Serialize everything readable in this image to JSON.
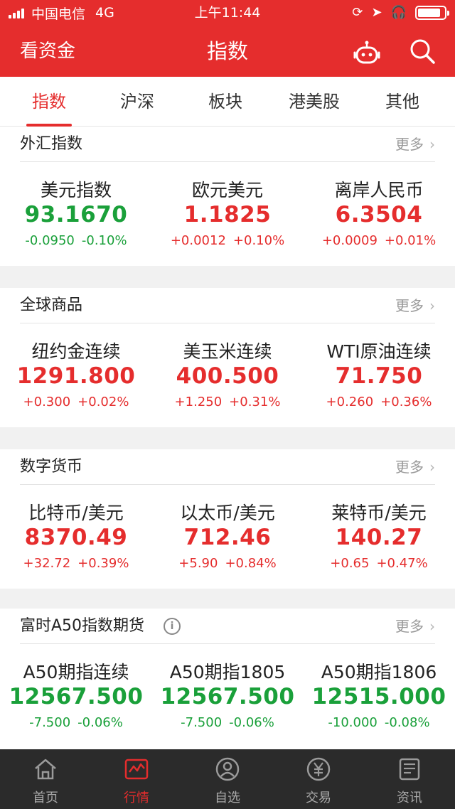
{
  "status_bar": {
    "carrier": "中国电信",
    "network": "4G",
    "time": "上午11:44"
  },
  "header": {
    "left_label": "看资金",
    "title": "指数",
    "icons": [
      "robot-icon",
      "search-icon"
    ]
  },
  "tabs": [
    {
      "label": "指数",
      "active": true
    },
    {
      "label": "沪深",
      "active": false
    },
    {
      "label": "板块",
      "active": false
    },
    {
      "label": "港美股",
      "active": false
    },
    {
      "label": "其他",
      "active": false
    }
  ],
  "more_label": "更多",
  "sections": [
    {
      "title": "外汇指数",
      "items": [
        {
          "name": "美元指数",
          "price": "93.1670",
          "change": "-0.0950",
          "pct": "-0.10%",
          "trend": "down"
        },
        {
          "name": "欧元美元",
          "price": "1.1825",
          "change": "+0.0012",
          "pct": "+0.10%",
          "trend": "up"
        },
        {
          "name": "离岸人民币",
          "price": "6.3504",
          "change": "+0.0009",
          "pct": "+0.01%",
          "trend": "up"
        }
      ]
    },
    {
      "title": "全球商品",
      "items": [
        {
          "name": "纽约金连续",
          "price": "1291.800",
          "change": "+0.300",
          "pct": "+0.02%",
          "trend": "up"
        },
        {
          "name": "美玉米连续",
          "price": "400.500",
          "change": "+1.250",
          "pct": "+0.31%",
          "trend": "up"
        },
        {
          "name": "WTI原油连续",
          "price": "71.750",
          "change": "+0.260",
          "pct": "+0.36%",
          "trend": "up"
        }
      ]
    },
    {
      "title": "数字货币",
      "items": [
        {
          "name": "比特币/美元",
          "price": "8370.49",
          "change": "+32.72",
          "pct": "+0.39%",
          "trend": "up"
        },
        {
          "name": "以太币/美元",
          "price": "712.46",
          "change": "+5.90",
          "pct": "+0.84%",
          "trend": "up"
        },
        {
          "name": "莱特币/美元",
          "price": "140.27",
          "change": "+0.65",
          "pct": "+0.47%",
          "trend": "up"
        }
      ]
    },
    {
      "title": "富时A50指数期货",
      "info_icon": true,
      "items": [
        {
          "name": "A50期指连续",
          "price": "12567.500",
          "change": "-7.500",
          "pct": "-0.06%",
          "trend": "down"
        },
        {
          "name": "A50期指1805",
          "price": "12567.500",
          "change": "-7.500",
          "pct": "-0.06%",
          "trend": "down"
        },
        {
          "name": "A50期指1806",
          "price": "12515.000",
          "change": "-10.000",
          "pct": "-0.08%",
          "trend": "down"
        }
      ]
    }
  ],
  "bottom_nav": [
    {
      "label": "首页",
      "icon": "home-icon",
      "active": false
    },
    {
      "label": "行情",
      "icon": "market-chart-icon",
      "active": true
    },
    {
      "label": "自选",
      "icon": "watchlist-user-icon",
      "active": false
    },
    {
      "label": "交易",
      "icon": "trade-yuan-icon",
      "active": false
    },
    {
      "label": "资讯",
      "icon": "news-icon",
      "active": false
    }
  ],
  "colors": {
    "brand_red": "#e52d2d",
    "up": "#e52d2d",
    "down": "#1aa03a",
    "nav_bg": "#2b2b2b"
  }
}
